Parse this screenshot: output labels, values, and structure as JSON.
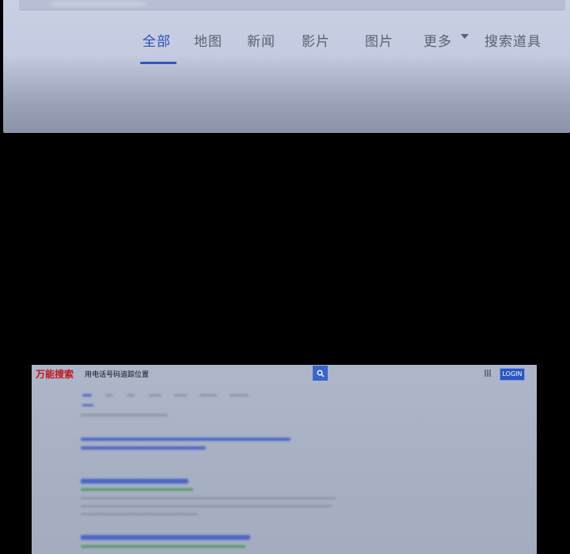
{
  "search_tabs": {
    "items": [
      {
        "label": "全部",
        "active": true
      },
      {
        "label": "地图",
        "active": false
      },
      {
        "label": "新闻",
        "active": false
      },
      {
        "label": "影片",
        "active": false
      },
      {
        "label": "图片",
        "active": false
      },
      {
        "label": "更多",
        "active": false,
        "icon": "chevron-down-icon"
      },
      {
        "label": "搜索道具",
        "active": false
      }
    ],
    "active_color": "#2d55c8"
  },
  "embedded_screenshot": {
    "brand": "万能搜索",
    "brand_color": "#c0181b",
    "query": "用电话号码追踪位置",
    "search_icon": "search-icon",
    "apps_icon": "grid-icon",
    "login_label": "LOGIN",
    "accent": "#2a56c2"
  }
}
